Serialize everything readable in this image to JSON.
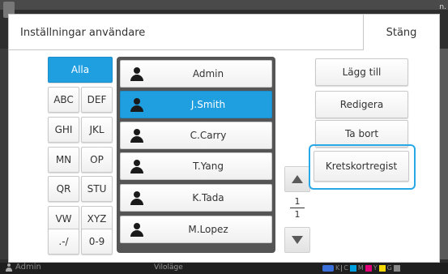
{
  "dialog": {
    "title": "Inställningar användare",
    "close_label": "Stäng"
  },
  "filters": [
    {
      "label": "Alla",
      "selected": true
    },
    {
      "label": "ABC"
    },
    {
      "label": "DEF"
    },
    {
      "label": "GHI"
    },
    {
      "label": "JKL"
    },
    {
      "label": "MN"
    },
    {
      "label": "OP"
    },
    {
      "label": "QR"
    },
    {
      "label": "STU"
    },
    {
      "label": "VW"
    },
    {
      "label": "XYZ"
    },
    {
      "label": ".-/"
    },
    {
      "label": "0-9"
    }
  ],
  "users": [
    {
      "name": "Admin"
    },
    {
      "name": "J.Smith",
      "selected": true
    },
    {
      "name": "C.Carry"
    },
    {
      "name": "T.Yang"
    },
    {
      "name": "K.Tada"
    },
    {
      "name": "M.Lopez"
    }
  ],
  "pager": {
    "current": "1",
    "total": "1"
  },
  "actions": {
    "add_label": "Lägg till",
    "edit_label": "Redigera",
    "delete_label": "Ta bort",
    "card_label": "Kretskortregist"
  },
  "status": {
    "user": "Admin",
    "mode": "Viloläge",
    "ink_labels": [
      "K",
      "C",
      "M",
      "Y",
      "G"
    ]
  },
  "background": {
    "corner_text": "n."
  },
  "colors": {
    "accent": "#1f9ee0",
    "focus": "#29a8e8",
    "ink_k": "#1a1a1a",
    "ink_c": "#00a0e0",
    "ink_m": "#e0007a",
    "ink_y": "#f5d800",
    "ink_g": "#888888"
  }
}
